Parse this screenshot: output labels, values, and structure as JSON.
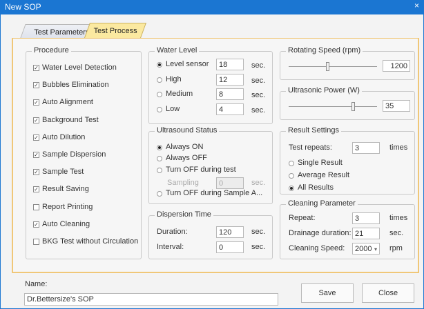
{
  "window": {
    "title": "New SOP",
    "close_glyph": "×"
  },
  "tabs": [
    {
      "label": "Test Parameters"
    },
    {
      "label": "Test Process"
    }
  ],
  "procedure": {
    "title": "Procedure",
    "items": [
      {
        "label": "Water Level Detection",
        "checked": true
      },
      {
        "label": "Bubbles Elimination",
        "checked": true
      },
      {
        "label": "Auto Alignment",
        "checked": true
      },
      {
        "label": "Background Test",
        "checked": true
      },
      {
        "label": "Auto Dilution",
        "checked": true
      },
      {
        "label": "Sample Dispersion",
        "checked": true
      },
      {
        "label": "Sample Test",
        "checked": true
      },
      {
        "label": "Result Saving",
        "checked": true
      },
      {
        "label": "Report Printing",
        "checked": false
      },
      {
        "label": "Auto Cleaning",
        "checked": true
      },
      {
        "label": "BKG Test without Circulation",
        "checked": false
      }
    ]
  },
  "water_level": {
    "title": "Water Level",
    "unit": "sec.",
    "options": [
      {
        "label": "Level sensor",
        "value": "18",
        "selected": true
      },
      {
        "label": "High",
        "value": "12",
        "selected": false
      },
      {
        "label": "Medium",
        "value": "8",
        "selected": false
      },
      {
        "label": "Low",
        "value": "4",
        "selected": false
      }
    ]
  },
  "ultrasound_status": {
    "title": "Ultrasound Status",
    "options": [
      {
        "label": "Always ON",
        "selected": true
      },
      {
        "label": "Always OFF",
        "selected": false
      },
      {
        "label": "Turn OFF during test",
        "selected": false
      },
      {
        "label": "Turn OFF during Sample A...",
        "selected": false
      }
    ],
    "sampling_label": "Sampling",
    "sampling_value": "0",
    "sampling_unit": "sec."
  },
  "dispersion_time": {
    "title": "Dispersion Time",
    "duration_label": "Duration:",
    "duration_value": "120",
    "interval_label": "Interval:",
    "interval_value": "0",
    "unit": "sec."
  },
  "rotating_speed": {
    "title": "Rotating Speed (rpm)",
    "value": "1200",
    "level": 0.44
  },
  "ultrasonic_power": {
    "title": "Ultrasonic Power (W)",
    "value": "35",
    "level": 0.73
  },
  "result_settings": {
    "title": "Result Settings",
    "repeats_label": "Test repeats:",
    "repeats_value": "3",
    "repeats_unit": "times",
    "options": [
      {
        "label": "Single Result",
        "selected": false
      },
      {
        "label": "Average Result",
        "selected": false
      },
      {
        "label": "All Results",
        "selected": true
      }
    ]
  },
  "cleaning": {
    "title": "Cleaning Parameter",
    "repeat_label": "Repeat:",
    "repeat_value": "3",
    "repeat_unit": "times",
    "drainage_label": "Drainage duration:",
    "drainage_value": "21",
    "drainage_unit": "sec.",
    "speed_label": "Cleaning Speed:",
    "speed_value": "2000",
    "speed_unit": "rpm"
  },
  "footer": {
    "name_label": "Name:",
    "name_value": "Dr.Bettersize's SOP",
    "save_label": "Save",
    "close_label": "Close"
  }
}
